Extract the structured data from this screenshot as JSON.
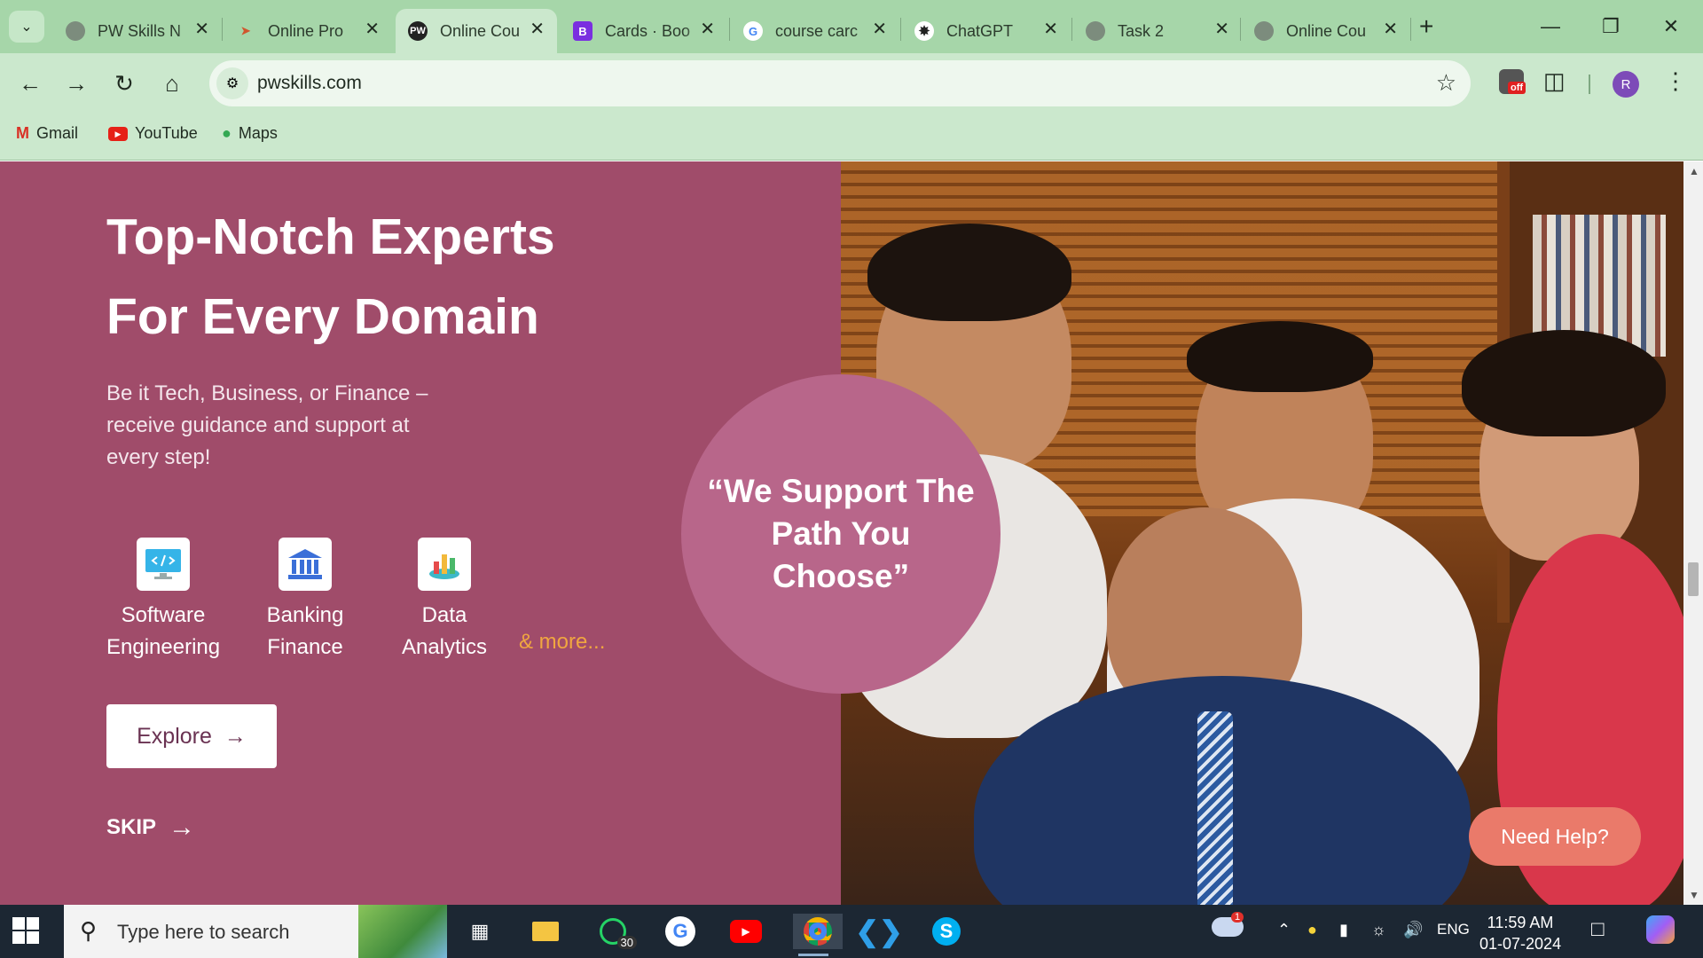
{
  "browser": {
    "tabs": [
      {
        "title": "PW Skills N",
        "favicon": "globe-icon",
        "active": false
      },
      {
        "title": "Online Pro",
        "favicon": "dart-icon",
        "active": false
      },
      {
        "title": "Online Cou",
        "favicon": "pw-logo-icon",
        "active": true
      },
      {
        "title": "Cards · Boo",
        "favicon": "bootstrap-icon",
        "active": false
      },
      {
        "title": "course carc",
        "favicon": "google-icon",
        "active": false
      },
      {
        "title": "ChatGPT",
        "favicon": "chatgpt-icon",
        "active": false
      },
      {
        "title": "Task 2",
        "favicon": "globe-icon",
        "active": false
      },
      {
        "title": "Online Cou",
        "favicon": "globe-icon",
        "active": false
      }
    ],
    "url": "pwskills.com",
    "extension_badge": "off",
    "profile_initial": "R",
    "bookmarks": [
      {
        "label": "Gmail",
        "icon": "gmail-icon"
      },
      {
        "label": "YouTube",
        "icon": "youtube-icon"
      },
      {
        "label": "Maps",
        "icon": "maps-icon"
      }
    ]
  },
  "hero": {
    "headline_line1": "Top-Notch Experts",
    "headline_line2": "For Every Domain",
    "subtext": "Be it Tech, Business, or Finance – receive guidance and support at every step!",
    "domains": [
      {
        "line1": "Software",
        "line2": "Engineering",
        "icon": "code-monitor-icon"
      },
      {
        "line1": "Banking",
        "line2": "Finance",
        "icon": "bank-icon"
      },
      {
        "line1": "Data",
        "line2": "Analytics",
        "icon": "chart-icon"
      }
    ],
    "more_label": "& more...",
    "explore_label": "Explore",
    "skip_label": "SKIP",
    "quote": "“We Support The Path You Choose”",
    "need_help_label": "Need Help?"
  },
  "taskbar": {
    "search_placeholder": "Type here to search",
    "whatsapp_badge": "30",
    "weather_badge": "1",
    "language": "ENG",
    "time": "11:59 AM",
    "date": "01-07-2024"
  },
  "colors": {
    "chrome_green": "#a6d6a9",
    "panel_magenta": "#a04c6a",
    "quote_circle": "#b8668a",
    "more_link": "#f0a640",
    "need_help": "#ea7a6a"
  }
}
